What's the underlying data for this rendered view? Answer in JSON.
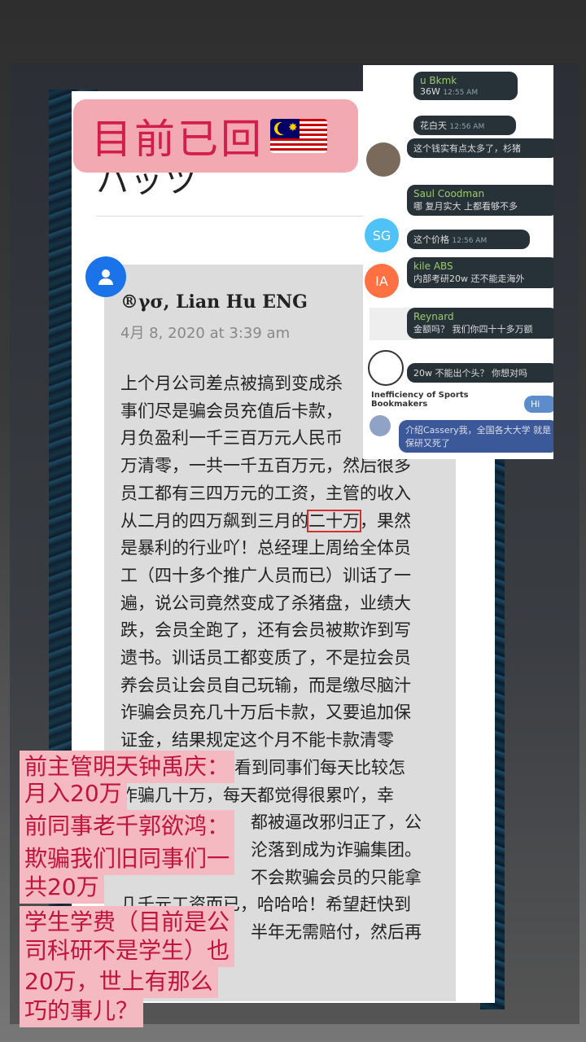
{
  "top_label": {
    "text": "目前已回"
  },
  "article": {
    "header": "ハッツ",
    "author": "®γσ, Lian Hu ENG",
    "date": "4月 8, 2020 at 3:39 am",
    "lines": [
      "上个月公司差点被搞到变成杀",
      "事们尽是骗会员充值后卡款，",
      "月负盈利一千三百万元人民币",
      "万清零，一共一千五百万元，然后很多",
      "员工都有三四万元的工资，主管的收入",
      "从二月的四万飙到三月的",
      "是暴利的行业吖！总经理上周给全体员",
      "工（四十多个推广人员而已）训话了一",
      "遍，说公司竟然变成了杀猪盘，业绩大",
      "跌，会员全跑了，还有会员被欺诈到写",
      "遗书。训话员工都变质了，不是拉会员",
      "养会员让会员自己玩输，而是缴尽脑汁",
      "诈骗会员充几十万后卡款，又要追加保",
      "证金，结果规定这个月不能卡款清零",
      "看到同事们每天比较怎",
      "诈骗几十万，每天都觉得很累吖，幸",
      "都被逼改邪归正了，公",
      "沦落到成为诈骗集团。",
      "不会欺骗会员的只能拿",
      "几千元工资而已，哈哈哈！希望赶快到",
      "半年无需赔付，然后再"
    ],
    "highlight": "二十万",
    "after_highlight": "，果然"
  },
  "chat": {
    "messages": [
      {
        "name": "u Bkmk",
        "text": "36W",
        "time": "12:55 AM"
      },
      {
        "text": "花白天",
        "time": "12:56 AM"
      },
      {
        "text": "这个钱实有点太多了，杉猪"
      },
      {
        "name": "Saul Coodman",
        "text": "哪 复月实大 上都看够不多"
      },
      {
        "text": "这个价格",
        "time": "12:56 AM"
      },
      {
        "name": "kile ABS",
        "text": "内部考研20w 还不能走海外"
      },
      {
        "name": "Reynard",
        "text": "金额吗？ 我们你四十十多万额"
      },
      {
        "text": "20w 不能出个头？ 你想对吗"
      },
      {
        "text": "Inefficiency of Sports Bookmakers"
      },
      {
        "text": "介绍Cassery我，全国各大大学 就是保研又死了"
      },
      {
        "text": "Hi"
      }
    ],
    "avatars": {
      "sg": "SG",
      "ia": "IA"
    },
    "colors": {
      "sg": "#4fc3f7",
      "ia": "#ff7043",
      "bubble": "#263238",
      "name": "#9ccc65"
    }
  },
  "overlay_notes": [
    "前主管明天钟禹庆：",
    "月入20万",
    "前同事老千郭欲鸿：",
    "欺骗我们旧同事们一",
    "共20万",
    "学生学费（目前是公",
    "司科研不是学生）也",
    "20万，世上有那么",
    "巧的事儿？"
  ],
  "colors": {
    "accent_pink": "#f2a9b1",
    "accent_red": "#d11e4a",
    "avatar_blue": "#1a73e8"
  }
}
